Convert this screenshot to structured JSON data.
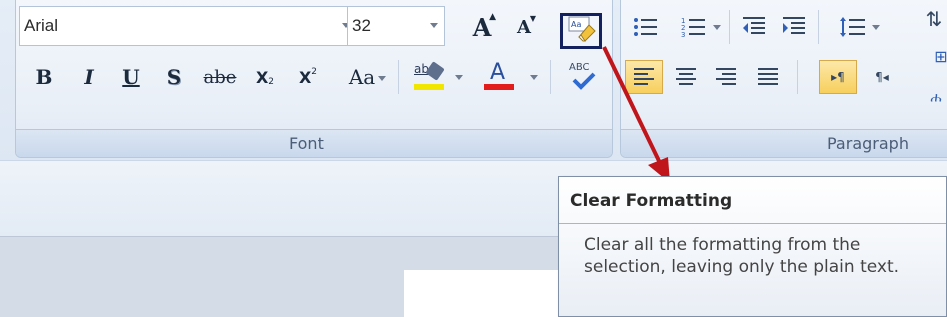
{
  "font_group": {
    "label": "Font",
    "font_name": "Arial",
    "font_size": "32",
    "grow_font": "A",
    "shrink_font": "A",
    "bold": "B",
    "italic": "I",
    "underline": "U",
    "shadow": "S",
    "strikethrough": "abe",
    "subscript": "X",
    "superscript": "X",
    "change_case": "Aa",
    "highlight_label": "ab",
    "font_color": "A",
    "spelling_label": "ABC"
  },
  "paragraph_group": {
    "label": "Paragraph"
  },
  "tooltip": {
    "title": "Clear Formatting",
    "body": "Clear all the formatting from the selection, leaving only the plain text."
  },
  "colors": {
    "highlight_border": "#13225f",
    "arrow": "#c0151b",
    "text_highlight": "#f1e600",
    "font_color_bar": "#e21b1b"
  },
  "icons": [
    "clear-formatting-icon",
    "bullets-icon",
    "numbering-icon",
    "decrease-indent-icon",
    "increase-indent-icon",
    "line-spacing-icon",
    "align-left-icon",
    "center-icon",
    "align-right-icon",
    "justify-icon",
    "ltr-icon",
    "rtl-icon",
    "spelling-icon"
  ]
}
